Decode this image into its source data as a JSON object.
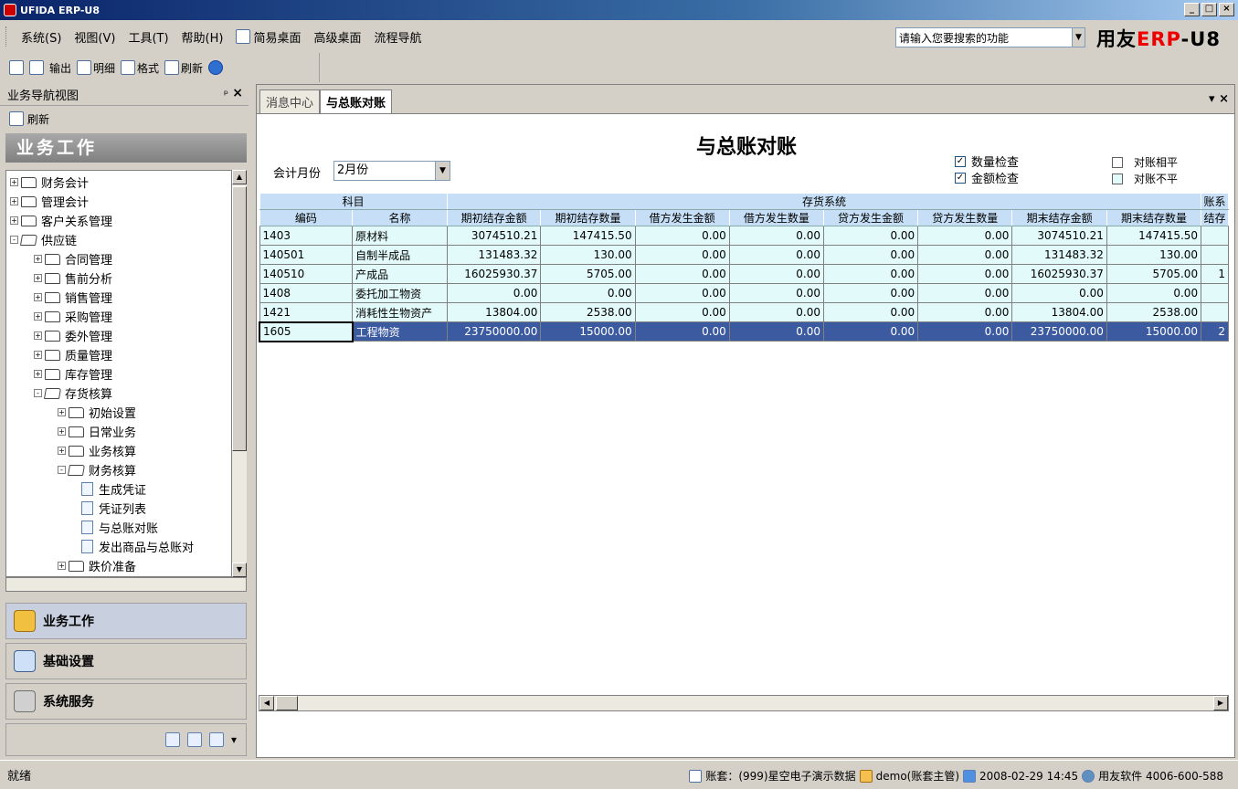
{
  "window": {
    "title": "UFIDA ERP-U8",
    "controls": [
      "_",
      "□",
      "×"
    ]
  },
  "menu": {
    "items": [
      "系统(S)",
      "视图(V)",
      "工具(T)",
      "帮助(H)",
      "简易桌面",
      "高级桌面",
      "流程导航"
    ],
    "search_placeholder": "请输入您要搜索的功能",
    "brand_prefix": "用友",
    "brand_erp": "ERP",
    "brand_suffix": "-U8"
  },
  "toolbar": {
    "items": [
      "输出",
      "明细",
      "格式",
      "刷新"
    ]
  },
  "left": {
    "header": "业务导航视图",
    "pin": "ᵖ",
    "close": "×",
    "refresh": "刷新",
    "section": "业务工作",
    "tree": [
      {
        "label": "财务会计",
        "level": 0,
        "exp": "+",
        "kind": "folder"
      },
      {
        "label": "管理会计",
        "level": 0,
        "exp": "+",
        "kind": "folder"
      },
      {
        "label": "客户关系管理",
        "level": 0,
        "exp": "+",
        "kind": "folder"
      },
      {
        "label": "供应链",
        "level": 0,
        "exp": "-",
        "kind": "open"
      },
      {
        "label": "合同管理",
        "level": 1,
        "exp": "+",
        "kind": "folder"
      },
      {
        "label": "售前分析",
        "level": 1,
        "exp": "+",
        "kind": "folder"
      },
      {
        "label": "销售管理",
        "level": 1,
        "exp": "+",
        "kind": "folder"
      },
      {
        "label": "采购管理",
        "level": 1,
        "exp": "+",
        "kind": "folder"
      },
      {
        "label": "委外管理",
        "level": 1,
        "exp": "+",
        "kind": "folder"
      },
      {
        "label": "质量管理",
        "level": 1,
        "exp": "+",
        "kind": "folder"
      },
      {
        "label": "库存管理",
        "level": 1,
        "exp": "+",
        "kind": "folder"
      },
      {
        "label": "存货核算",
        "level": 1,
        "exp": "-",
        "kind": "open"
      },
      {
        "label": "初始设置",
        "level": 2,
        "exp": "+",
        "kind": "folder"
      },
      {
        "label": "日常业务",
        "level": 2,
        "exp": "+",
        "kind": "folder"
      },
      {
        "label": "业务核算",
        "level": 2,
        "exp": "+",
        "kind": "folder"
      },
      {
        "label": "财务核算",
        "level": 2,
        "exp": "-",
        "kind": "open"
      },
      {
        "label": "生成凭证",
        "level": 3,
        "exp": "",
        "kind": "leaf"
      },
      {
        "label": "凭证列表",
        "level": 3,
        "exp": "",
        "kind": "leaf"
      },
      {
        "label": "与总账对账",
        "level": 3,
        "exp": "",
        "kind": "leaf"
      },
      {
        "label": "发出商品与总账对",
        "level": 3,
        "exp": "",
        "kind": "leaf"
      },
      {
        "label": "跌价准备",
        "level": 2,
        "exp": "+",
        "kind": "folder"
      }
    ],
    "nav": [
      "业务工作",
      "基础设置",
      "系统服务"
    ]
  },
  "main": {
    "tabs": [
      "消息中心",
      "与总账对账"
    ],
    "tab_controls": "▾ ×",
    "title": "与总账对账",
    "month_label": "会计月份",
    "month_value": "2月份",
    "checks": [
      {
        "label": "数量检查",
        "checked": "✓"
      },
      {
        "label": "金额检查",
        "checked": "✓"
      }
    ],
    "legend": [
      "对账相平",
      "对账不平"
    ],
    "group_headers": {
      "subject": "科目",
      "inventory": "存货系统",
      "ledger": "账系"
    },
    "columns": [
      "编码",
      "名称",
      "期初结存金额",
      "期初结存数量",
      "借方发生金额",
      "借方发生数量",
      "贷方发生金额",
      "贷方发生数量",
      "期末结存金额",
      "期末结存数量",
      "结存"
    ],
    "rows": [
      [
        "1403",
        "原材料",
        "3074510.21",
        "147415.50",
        "0.00",
        "0.00",
        "0.00",
        "0.00",
        "3074510.21",
        "147415.50",
        ""
      ],
      [
        "140501",
        "自制半成品",
        "131483.32",
        "130.00",
        "0.00",
        "0.00",
        "0.00",
        "0.00",
        "131483.32",
        "130.00",
        ""
      ],
      [
        "140510",
        "产成品",
        "16025930.37",
        "5705.00",
        "0.00",
        "0.00",
        "0.00",
        "0.00",
        "16025930.37",
        "5705.00",
        "1"
      ],
      [
        "1408",
        "委托加工物资",
        "0.00",
        "0.00",
        "0.00",
        "0.00",
        "0.00",
        "0.00",
        "0.00",
        "0.00",
        ""
      ],
      [
        "1421",
        "消耗性生物资产",
        "13804.00",
        "2538.00",
        "0.00",
        "0.00",
        "0.00",
        "0.00",
        "13804.00",
        "2538.00",
        ""
      ],
      [
        "1605",
        "工程物资",
        "23750000.00",
        "15000.00",
        "0.00",
        "0.00",
        "0.00",
        "0.00",
        "23750000.00",
        "15000.00",
        "2"
      ]
    ]
  },
  "status": {
    "left": "就绪",
    "account": "账套：(999)星空电子演示数据",
    "user": "demo(账套主管)",
    "datetime": "2008-02-29 14:45",
    "company": "用友软件 4006-600-588"
  }
}
